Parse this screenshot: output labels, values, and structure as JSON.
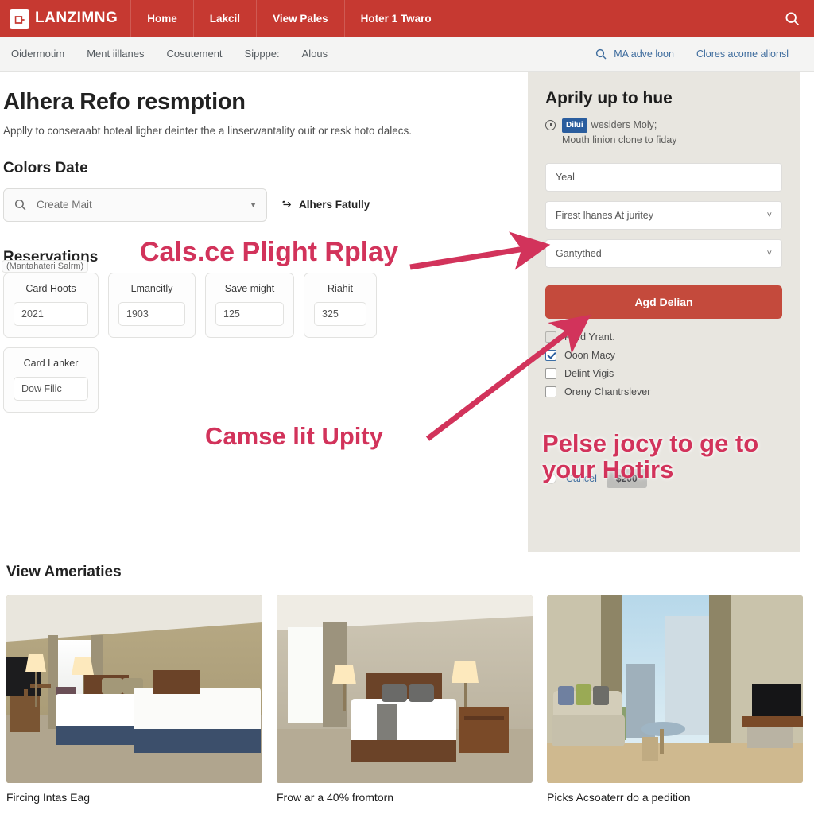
{
  "header": {
    "brand": "LANZIMNG",
    "logo_icon": "leaf-logo-icon",
    "nav": [
      {
        "label": "Home"
      },
      {
        "label": "Lakcil"
      },
      {
        "label": "View Pales"
      },
      {
        "label": "Hoter 1 Twaro"
      }
    ],
    "search_icon": "search-icon",
    "bar_color": "#c63931"
  },
  "subnav": {
    "items": [
      {
        "label": "Oidermotim"
      },
      {
        "label": "Ment iillanes"
      },
      {
        "label": "Cosutement"
      },
      {
        "label": "Sipppe:"
      },
      {
        "label": "Alous"
      }
    ],
    "right": {
      "search_icon": "search-icon",
      "search_link": "MA adve loon",
      "secondary_link": "Clores acome alionsl",
      "link_color": "#3f6d9e"
    }
  },
  "main": {
    "title": "Alhera Refo resmption",
    "lead": "Applly to conseraabt hoteal ligher deinter the a linserwantality ouit or resk hoto dalecs.",
    "section_date_title": "Colors Date",
    "date_select": {
      "icon": "search-icon",
      "value": "Create Mait",
      "caret_icon": "chevron-down-icon"
    },
    "side_link": {
      "icon": "share-icon",
      "label": "Alhers Fatully"
    },
    "section_reservations_title": "Reservations",
    "card_tag": "(Mantahateri Salrm)",
    "cards": [
      {
        "title": "Card Hoots",
        "value": "2021"
      },
      {
        "title": "Lmancitly",
        "value": "1903"
      },
      {
        "title": "Save might",
        "value": "12\u00155"
      },
      {
        "title": "Riahit",
        "value": "325"
      }
    ],
    "cards_row2": [
      {
        "title": "Card Lanker",
        "value": "Dow Filic"
      }
    ]
  },
  "aside": {
    "title": "Aprily up to hue",
    "note_icon": "clock-icon",
    "note_badge": "Dilui",
    "note_line1": "wesiders Moly;",
    "note_line2": "Mouth linion clone to fiday",
    "badge_color": "#2a5d9e",
    "fields": [
      {
        "kind": "text",
        "value": "Yeal"
      },
      {
        "kind": "select",
        "value": "Firest lhanes At juritey",
        "caret_icon": "chevron-down-icon"
      },
      {
        "kind": "select",
        "value": "Gantythed",
        "caret_icon": "chevron-down-icon"
      }
    ],
    "cta_label": "Agd Delian",
    "cta_color": "#c44a3c",
    "checkboxes": [
      {
        "label": "Filed Yrant.",
        "state": "dim"
      },
      {
        "label": "Ooon Macy",
        "state": "on"
      },
      {
        "label": "Delint Vigis",
        "state": "off"
      },
      {
        "label": "Oreny Chantrslever",
        "state": "off"
      }
    ],
    "footer": {
      "radio_icon": "radio-button-icon",
      "cancel_label": "Cancel",
      "price": "$200"
    },
    "bg_color": "#e8e6e0"
  },
  "annotations": {
    "color": "#d2335b",
    "items": [
      {
        "text": "Cals.ce Plight Rplay"
      },
      {
        "text": "Camse lit Upity"
      },
      {
        "text": "Pelse jocy to ge to your Hotirs"
      }
    ]
  },
  "gallery": {
    "title": "View Ameriaties",
    "items": [
      {
        "caption": "Fircing Intas Eag",
        "alt": "twin-beds-hotel-room"
      },
      {
        "caption": "Frow ar a 40% fromtorn",
        "alt": "queen-bed-hotel-room"
      },
      {
        "caption": "Picks Acsoaterr do a pedition",
        "alt": "suite-with-city-view"
      }
    ]
  }
}
